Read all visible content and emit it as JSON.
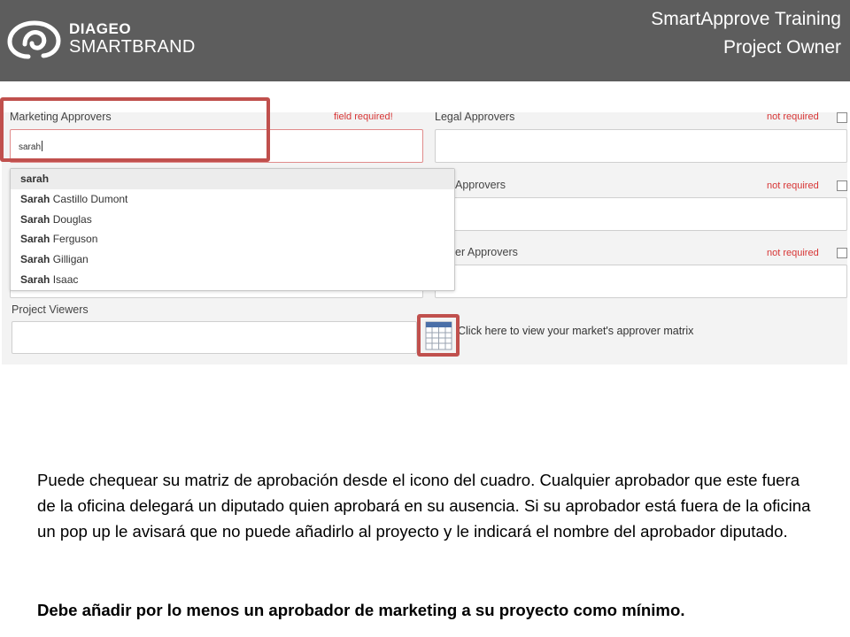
{
  "header": {
    "logo_line1": "DIAGEO",
    "logo_line2": "SMARTBRAND",
    "title_line1": "SmartApprove Training",
    "title_line2": "Project Owner",
    "background": "#5d5d5d"
  },
  "form": {
    "marketing": {
      "label": "Marketing Approvers",
      "status": "field required!",
      "value": "sarah"
    },
    "legal": {
      "label": "Legal Approvers",
      "status": "not required"
    },
    "second": {
      "label_partial": "Approvers",
      "status": "not required"
    },
    "third": {
      "label_partial": "er Approvers",
      "status": "not required"
    },
    "viewers": {
      "label": "Project Viewers"
    },
    "matrix_link": "Click here to view your market's approver matrix",
    "suggestions": [
      {
        "bold": "sarah",
        "rest": ""
      },
      {
        "bold": "Sarah",
        "rest": " Castillo Dumont"
      },
      {
        "bold": "Sarah",
        "rest": " Douglas"
      },
      {
        "bold": "Sarah",
        "rest": " Ferguson"
      },
      {
        "bold": "Sarah",
        "rest": " Gilligan"
      },
      {
        "bold": "Sarah",
        "rest": " Isaac"
      }
    ]
  },
  "body": {
    "paragraph": "Puede chequear su matriz de aprobación desde el icono del cuadro.  Cualquier aprobador que este fuera de la oficina delegará un diputado quien aprobará en su ausencia.  Si su aprobador está fuera de la oficina un pop up le avisará que no puede añadirlo al proyecto y le indicará el nombre del aprobador diputado.",
    "bold_note": "Debe añadir por lo menos un aprobador de marketing a su proyecto como mínimo."
  },
  "colors": {
    "accent_red": "#c0504d",
    "required_red": "#d73535"
  },
  "icons": [
    "diageo-swirl-logo-icon",
    "approver-matrix-table-icon"
  ]
}
